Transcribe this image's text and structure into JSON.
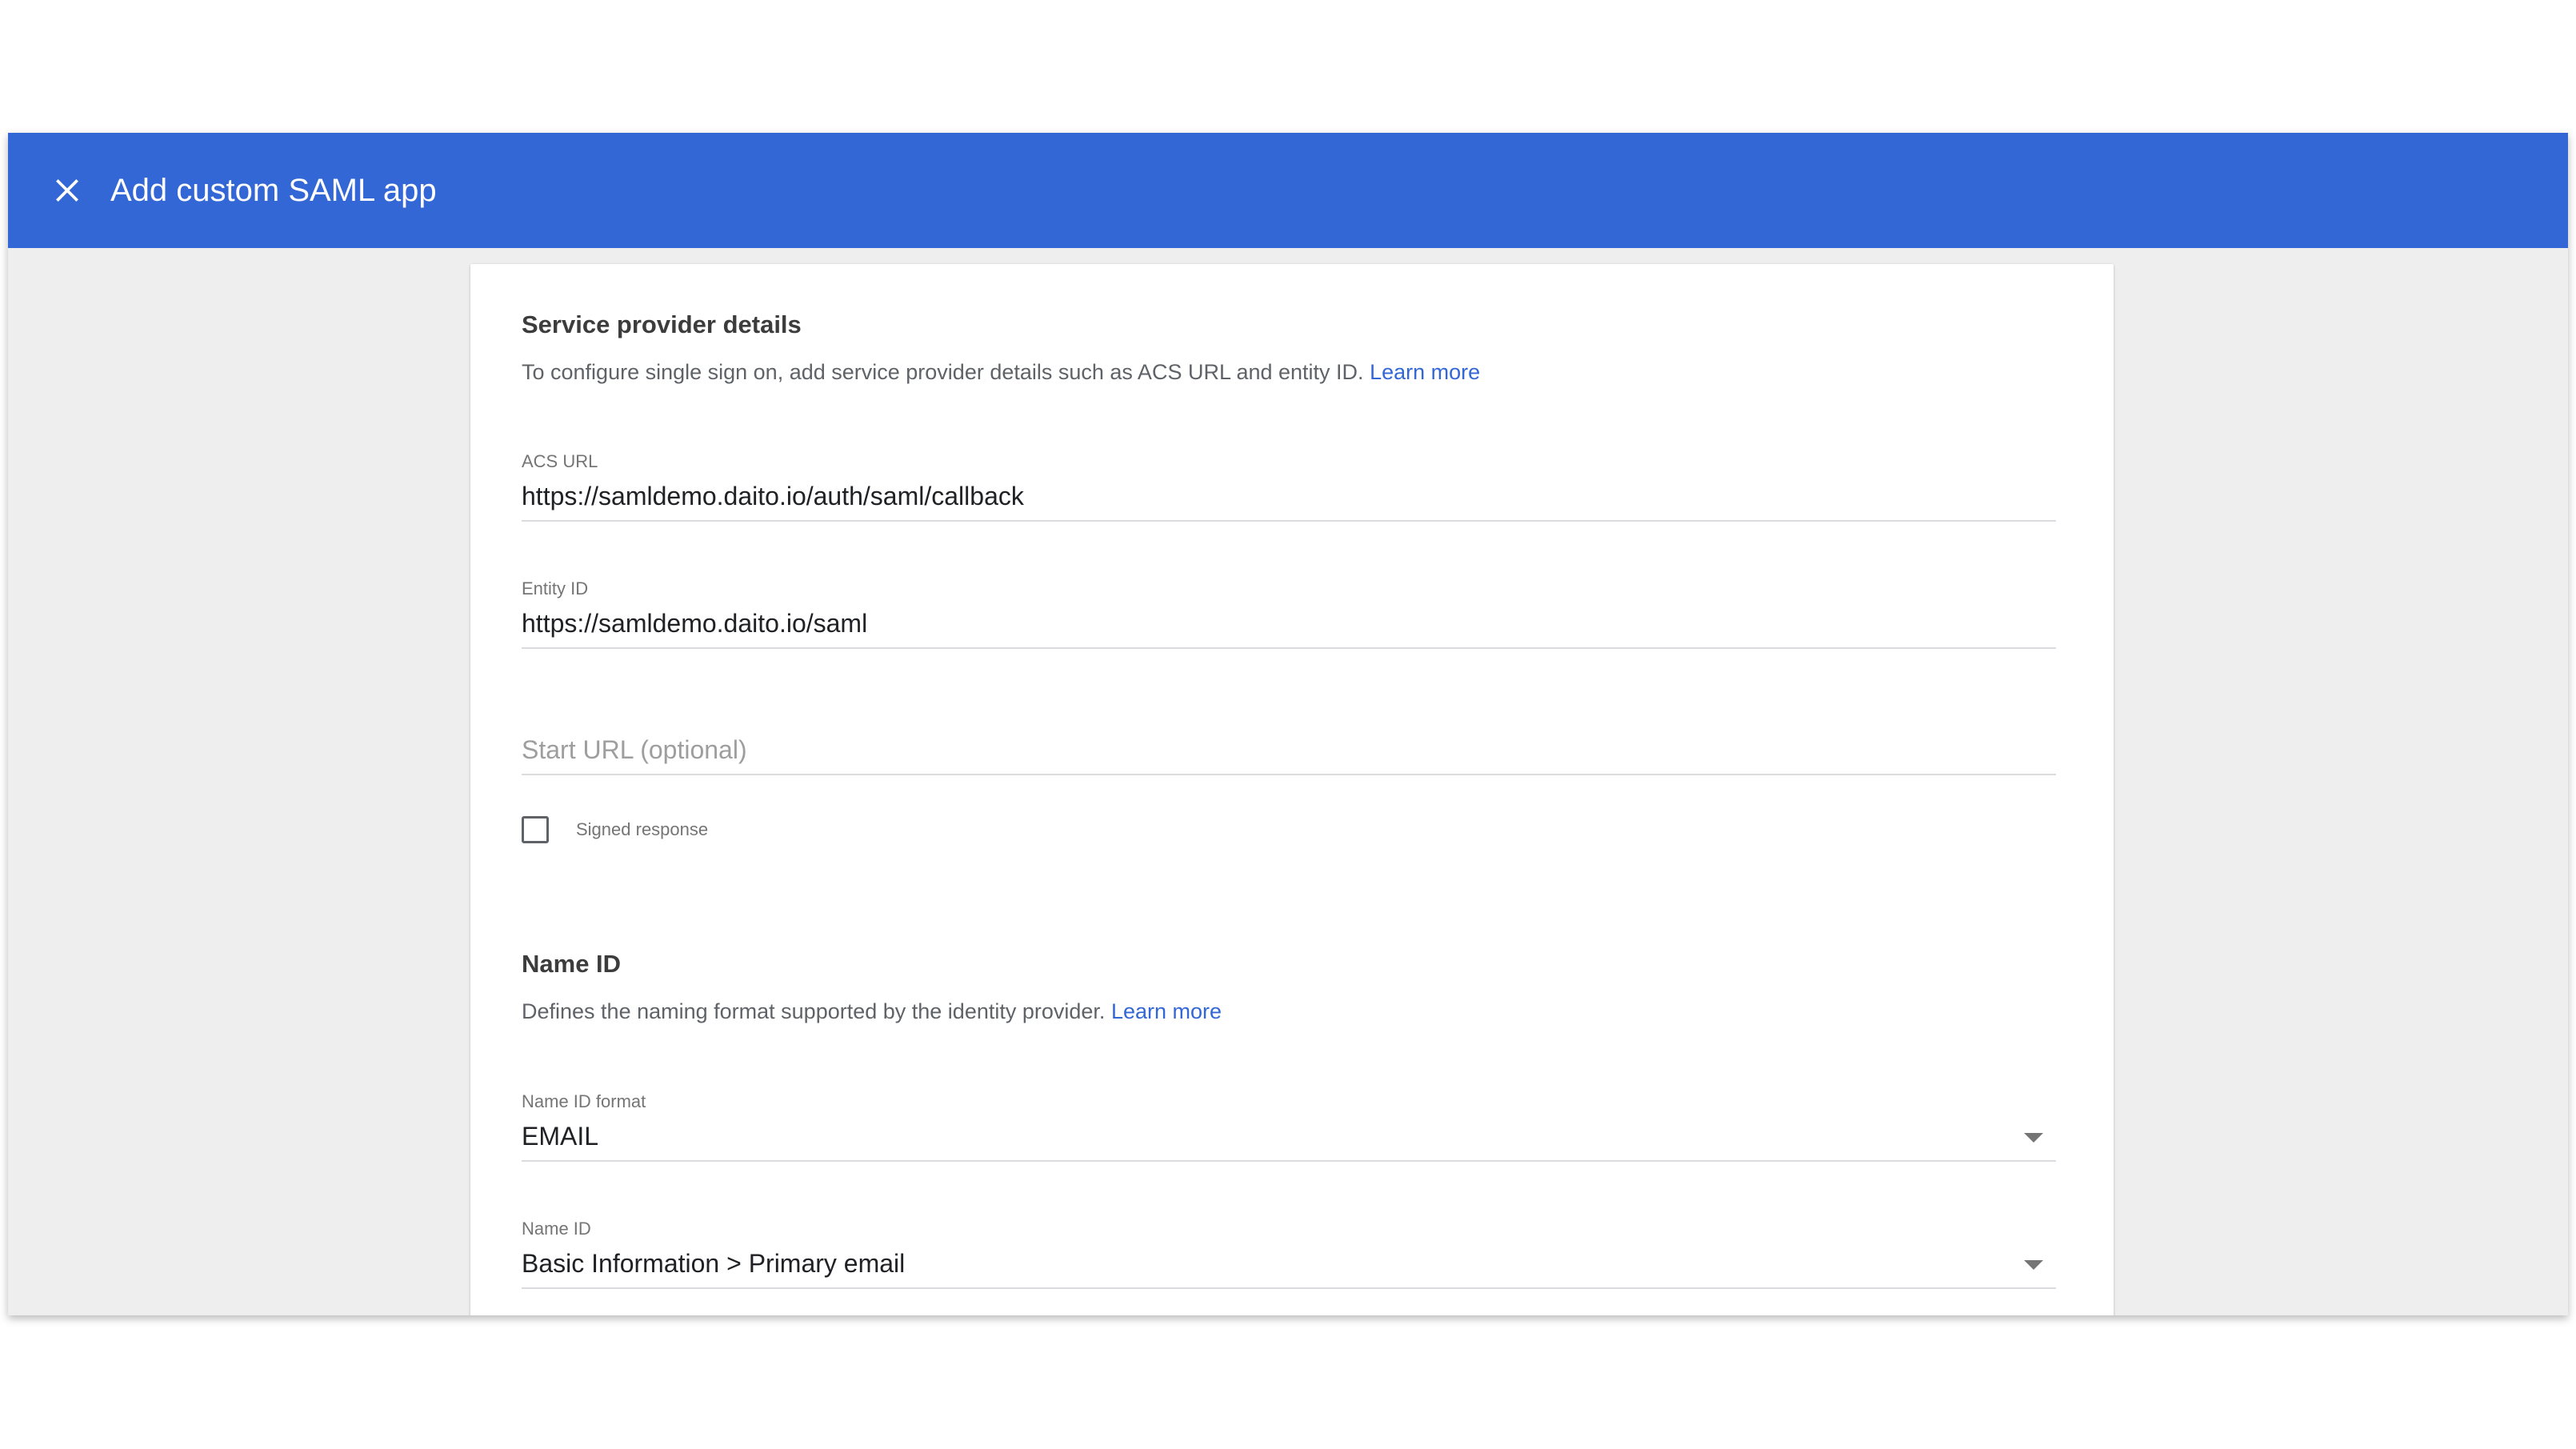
{
  "header": {
    "title": "Add custom SAML app",
    "close_icon": "close-icon",
    "background_color": "#3367d6"
  },
  "service_provider": {
    "title": "Service provider details",
    "description": "To configure single sign on, add service provider details such as ACS URL and entity ID.",
    "learn_more": "Learn more",
    "acs_url": {
      "label": "ACS URL",
      "value": "https://samldemo.daito.io/auth/saml/callback"
    },
    "entity_id": {
      "label": "Entity ID",
      "value": "https://samldemo.daito.io/saml"
    },
    "start_url": {
      "placeholder": "Start URL (optional)"
    },
    "signed_response": {
      "label": "Signed response",
      "checked": false
    }
  },
  "name_id": {
    "title": "Name ID",
    "description": "Defines the naming format supported by the identity provider.",
    "learn_more": "Learn more",
    "format": {
      "label": "Name ID format",
      "value": "EMAIL"
    },
    "name_id_field": {
      "label": "Name ID",
      "value": "Basic Information > Primary email"
    }
  },
  "colors": {
    "accent": "#3367d6",
    "page_background": "#eeeeee"
  }
}
